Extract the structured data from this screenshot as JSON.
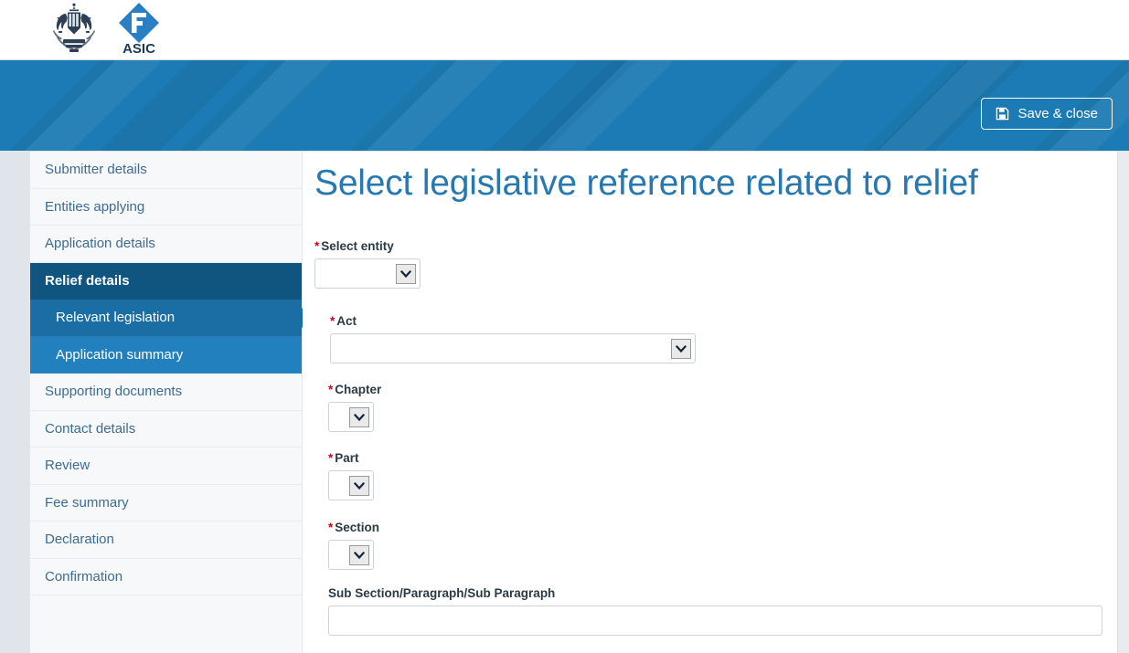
{
  "header": {
    "coat_of_arms_alt": "Australian Government Coat of Arms",
    "brand_name": "ASIC",
    "save_close_label": "Save & close",
    "banner_color": "#1c7bb4"
  },
  "sidebar": {
    "items": [
      {
        "label": "Submitter details",
        "state": "normal",
        "level": 0
      },
      {
        "label": "Entities applying",
        "state": "normal",
        "level": 0
      },
      {
        "label": "Application details",
        "state": "normal",
        "level": 0
      },
      {
        "label": "Relief details",
        "state": "active-parent",
        "level": 0
      },
      {
        "label": "Relevant legislation",
        "state": "current",
        "level": 1
      },
      {
        "label": "Application summary",
        "state": "sub",
        "level": 1
      },
      {
        "label": "Supporting documents",
        "state": "normal",
        "level": 0
      },
      {
        "label": "Contact details",
        "state": "normal",
        "level": 0
      },
      {
        "label": "Review",
        "state": "normal",
        "level": 0
      },
      {
        "label": "Fee summary",
        "state": "normal",
        "level": 0
      },
      {
        "label": "Declaration",
        "state": "normal",
        "level": 0
      },
      {
        "label": "Confirmation",
        "state": "normal",
        "level": 0
      }
    ],
    "colors": {
      "active_parent": "#0f5580",
      "current": "#1b6ea3",
      "sub": "#2180bd",
      "link_text": "#3d6c92"
    }
  },
  "main": {
    "title": "Select legislative reference related to relief",
    "required_marker": "*",
    "fields": {
      "entity": {
        "label": "Select entity",
        "required": true,
        "value": "",
        "control": "select"
      },
      "act": {
        "label": "Act",
        "required": true,
        "value": "",
        "control": "select"
      },
      "chapter": {
        "label": "Chapter",
        "required": true,
        "value": "",
        "control": "select"
      },
      "part": {
        "label": "Part",
        "required": true,
        "value": "",
        "control": "select"
      },
      "section": {
        "label": "Section",
        "required": true,
        "value": "",
        "control": "select"
      },
      "subsection": {
        "label": "Sub Section/Paragraph/Sub Paragraph",
        "required": false,
        "value": "",
        "placeholder": "",
        "control": "text"
      }
    }
  }
}
